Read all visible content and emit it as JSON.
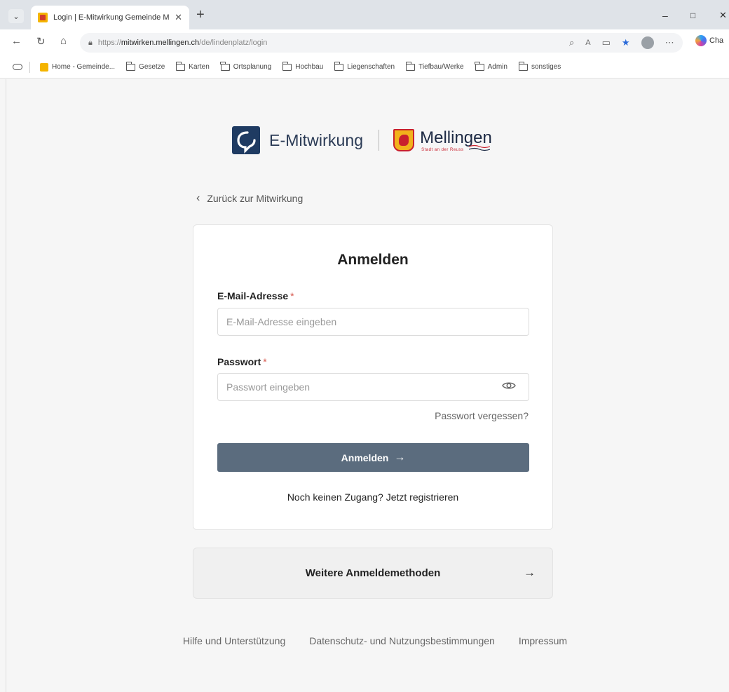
{
  "browser": {
    "tab_title": "Login | E-Mitwirkung Gemeinde M",
    "tab_close": "✕",
    "new_tab": "+",
    "minimize": "–",
    "maximize": "□",
    "close": "✕",
    "url_scheme": "https://",
    "url_host": "mitwirken.mellingen.ch",
    "url_path": "/de/lindenplatz/login",
    "copilot_label": "Cha",
    "bookmarks": [
      {
        "label": "Home - Gemeinde..."
      },
      {
        "label": "Gesetze"
      },
      {
        "label": "Karten"
      },
      {
        "label": "Ortsplanung"
      },
      {
        "label": "Hochbau"
      },
      {
        "label": "Liegenschaften"
      },
      {
        "label": "Tiefbau/Werke"
      },
      {
        "label": "Admin"
      },
      {
        "label": "sonstiges"
      }
    ]
  },
  "brand": {
    "app_name": "E-Mitwirkung",
    "municipality": "Mellingen",
    "municipality_tagline": "Stadt an der Reuss"
  },
  "nav": {
    "back_label": "Zurück zur Mitwirkung"
  },
  "login": {
    "title": "Anmelden",
    "email_label": "E-Mail-Adresse",
    "email_placeholder": "E-Mail-Adresse eingeben",
    "password_label": "Passwort",
    "password_placeholder": "Passwort eingeben",
    "required_marker": "*",
    "forgot_password": "Passwort vergessen?",
    "submit_label": "Anmelden",
    "submit_arrow": "→",
    "no_account": "Noch keinen Zugang?",
    "register_link": "Jetzt registrieren"
  },
  "alt_login": {
    "label": "Weitere Anmeldemethoden",
    "arrow": "→"
  },
  "footer": {
    "help": "Hilfe und Unterstützung",
    "privacy": "Datenschutz- und Nutzungsbestimmungen",
    "imprint": "Impressum"
  },
  "colors": {
    "primary_button": "#5b6c7e",
    "brand_navy": "#1f3b62",
    "required": "#d6574d"
  }
}
